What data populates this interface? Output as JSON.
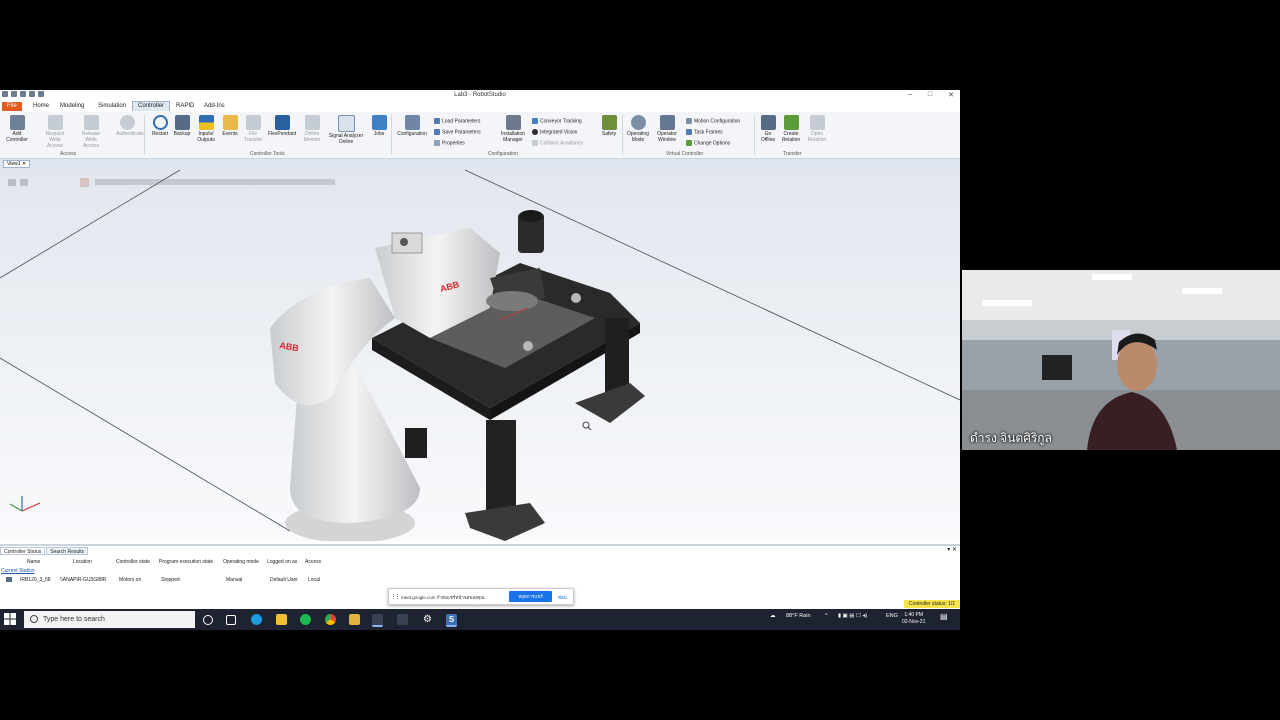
{
  "window": {
    "title": "Lab3 - RobotStudio"
  },
  "tabs": [
    "File",
    "Home",
    "Modeling",
    "Simulation",
    "Controller",
    "RAPID",
    "Add-Ins"
  ],
  "active_tab": "Controller",
  "ribbon": {
    "access": {
      "add_controller": "Add Controller",
      "request_write": "Request Write Access",
      "release_write": "Release Write Access",
      "authenticate": "Authenticate",
      "label": "Access"
    },
    "tools": {
      "restart": "Restart",
      "backup": "Backup",
      "io": "Inputs/ Outputs",
      "events": "Events",
      "file_transfer": "File Transfer",
      "flexpendant": "FlexPendant",
      "online_monitor": "Online Monitor",
      "signal_analyzer": "Signal Analyzer Online",
      "jobs": "Jobs",
      "label": "Controller Tools"
    },
    "configuration": {
      "configuration": "Configuration",
      "load_parameters": "Load Parameters",
      "save_parameters": "Save Parameters",
      "properties": "Properties",
      "installation_manager": "Installation Manager",
      "conveyor_tracking": "Conveyor Tracking",
      "integrated_vision": "Integrated Vision",
      "collision_avoidance": "Collision Avoidance",
      "safety": "Safety",
      "label": "Configuration"
    },
    "virtual": {
      "operating_mode": "Operating Mode",
      "operator_window": "Operator Window",
      "motion_configuration": "Motion Configuration",
      "task_frames": "Task Frames",
      "change_options": "Change Options",
      "label": "Virtual Controller"
    },
    "transfer": {
      "go_offline": "Go Offline",
      "create_relation": "Create Relation",
      "open_relation": "Open Relation",
      "label": "Transfer"
    }
  },
  "view_tab": "View1",
  "robot_brand": "ABB",
  "panel": {
    "tabs": [
      "Controller Status",
      "Search Results"
    ],
    "headers": [
      "Name",
      "Location",
      "Controller state",
      "Program execution state",
      "Operating mode",
      "Logged on as",
      "Access"
    ],
    "current_station": "Current Station",
    "row": {
      "name": "IRB120_3_58",
      "location": "\\\\ANAPIR-GU3G88R",
      "controller_state": "Motors on",
      "program_state": "Stopped",
      "operating_mode": "Manual",
      "logged_on": "Default User",
      "access": "Local"
    }
  },
  "notification": {
    "message": "meet.google.com กำลังแชร์หน้าจอของคุณ",
    "stop_button": "หยุดการแชร์",
    "hide": "ซ่อน"
  },
  "controller_status": "Controller status: 1/1",
  "taskbar": {
    "search_placeholder": "Type here to search",
    "weather": "88°F Rain",
    "lang": "ENG",
    "time": "1:40 PM",
    "date": "02-Nov-21"
  },
  "webcam": {
    "name": "ดำรง จินตศิริกูล"
  },
  "colors": {
    "file_tab": "#e35b1e",
    "accent": "#1a73e8",
    "taskbar": "#1d2330",
    "status": "#f8e34b"
  }
}
